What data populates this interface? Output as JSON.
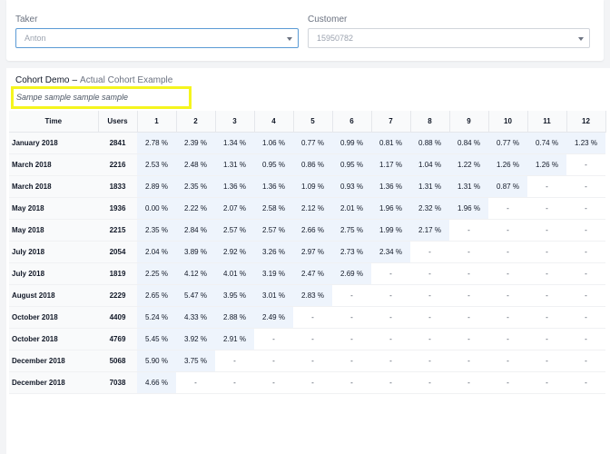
{
  "filters": {
    "taker": {
      "label": "Taker",
      "value": "Anton"
    },
    "customer": {
      "label": "Customer",
      "value": "15950782"
    }
  },
  "card": {
    "title": "Cohort Demo",
    "separator": "–",
    "subtitle": "Actual Cohort Example",
    "description": "Sampe sample sample sample"
  },
  "table": {
    "headers": [
      "Time",
      "Users",
      "1",
      "2",
      "3",
      "4",
      "5",
      "6",
      "7",
      "8",
      "9",
      "10",
      "11",
      "12"
    ],
    "rows": [
      {
        "time": "January 2018",
        "users": "2841",
        "values": [
          "2.78 %",
          "2.39 %",
          "1.34 %",
          "1.06 %",
          "0.77 %",
          "0.99 %",
          "0.81 %",
          "0.88 %",
          "0.84 %",
          "0.77 %",
          "0.74 %",
          "1.23 %"
        ]
      },
      {
        "time": "March 2018",
        "users": "2216",
        "values": [
          "2.53 %",
          "2.48 %",
          "1.31 %",
          "0.95 %",
          "0.86 %",
          "0.95 %",
          "1.17 %",
          "1.04 %",
          "1.22 %",
          "1.26 %",
          "1.26 %",
          "-"
        ]
      },
      {
        "time": "March 2018",
        "users": "1833",
        "values": [
          "2.89 %",
          "2.35 %",
          "1.36 %",
          "1.36 %",
          "1.09 %",
          "0.93 %",
          "1.36 %",
          "1.31 %",
          "1.31 %",
          "0.87 %",
          "-",
          "-"
        ]
      },
      {
        "time": "May 2018",
        "users": "1936",
        "values": [
          "0.00 %",
          "2.22 %",
          "2.07 %",
          "2.58 %",
          "2.12 %",
          "2.01 %",
          "1.96 %",
          "2.32 %",
          "1.96 %",
          "-",
          "-",
          "-"
        ]
      },
      {
        "time": "May 2018",
        "users": "2215",
        "values": [
          "2.35 %",
          "2.84 %",
          "2.57 %",
          "2.57 %",
          "2.66 %",
          "2.75 %",
          "1.99 %",
          "2.17 %",
          "-",
          "-",
          "-",
          "-"
        ]
      },
      {
        "time": "July 2018",
        "users": "2054",
        "values": [
          "2.04 %",
          "3.89 %",
          "2.92 %",
          "3.26 %",
          "2.97 %",
          "2.73 %",
          "2.34 %",
          "-",
          "-",
          "-",
          "-",
          "-"
        ]
      },
      {
        "time": "July 2018",
        "users": "1819",
        "values": [
          "2.25 %",
          "4.12 %",
          "4.01 %",
          "3.19 %",
          "2.47 %",
          "2.69 %",
          "-",
          "-",
          "-",
          "-",
          "-",
          "-"
        ]
      },
      {
        "time": "August 2018",
        "users": "2229",
        "values": [
          "2.65 %",
          "5.47 %",
          "3.95 %",
          "3.01 %",
          "2.83 %",
          "-",
          "-",
          "-",
          "-",
          "-",
          "-",
          "-"
        ]
      },
      {
        "time": "October 2018",
        "users": "4409",
        "values": [
          "5.24 %",
          "4.33 %",
          "2.88 %",
          "2.49 %",
          "-",
          "-",
          "-",
          "-",
          "-",
          "-",
          "-",
          "-"
        ]
      },
      {
        "time": "October 2018",
        "users": "4769",
        "values": [
          "5.45 %",
          "3.92 %",
          "2.91 %",
          "-",
          "-",
          "-",
          "-",
          "-",
          "-",
          "-",
          "-",
          "-"
        ]
      },
      {
        "time": "December 2018",
        "users": "5068",
        "values": [
          "5.90 %",
          "3.75 %",
          "-",
          "-",
          "-",
          "-",
          "-",
          "-",
          "-",
          "-",
          "-",
          "-"
        ]
      },
      {
        "time": "December 2018",
        "users": "7038",
        "values": [
          "4.66 %",
          "-",
          "-",
          "-",
          "-",
          "-",
          "-",
          "-",
          "-",
          "-",
          "-",
          "-"
        ]
      }
    ]
  },
  "colors": {
    "accent_border": "#5b9bd5",
    "highlight": "#f5f51e",
    "cell_fill": "#eef4fc"
  },
  "icons": {
    "dropdown": "chevron-down-icon"
  }
}
